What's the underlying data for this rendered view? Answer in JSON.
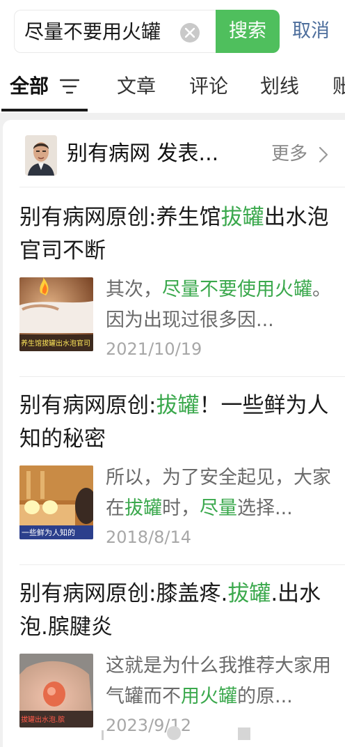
{
  "search": {
    "query": "尽量不要用火罐",
    "search_label": "搜索",
    "cancel_label": "取消"
  },
  "tabs": [
    {
      "label": "全部",
      "active": true
    },
    {
      "label": "文章",
      "active": false
    },
    {
      "label": "评论",
      "active": false
    },
    {
      "label": "划线",
      "active": false
    },
    {
      "label": "账",
      "active": false
    }
  ],
  "source": {
    "name": "别有病网 发表...",
    "more_label": "更多"
  },
  "results": [
    {
      "title_parts": [
        "别有病网原创:养生馆",
        "拔罐",
        "出水泡官司不断"
      ],
      "snippet_parts": [
        "其次，",
        "尽量不要使用火罐",
        "。因为出现过很多因..."
      ],
      "date": "2021/10/19",
      "thumb_caption": "养生馆拔罐出水泡官司"
    },
    {
      "title_parts": [
        "别有病网原创:",
        "拔罐",
        "！一些鲜为人知的秘密"
      ],
      "snippet_parts": [
        "所以，为了安全起见，大家在",
        "拔罐",
        "时，",
        "尽量",
        "选择..."
      ],
      "date": "2018/8/14",
      "thumb_caption": "一些鲜为人知的"
    },
    {
      "title_parts": [
        "别有病网原创:膝盖疼.",
        "拔罐",
        ".出水泡.膑腱炎"
      ],
      "snippet_parts": [
        "这就是为什么我推荐大家用气罐而不",
        "用火罐",
        "的原..."
      ],
      "date": "2023/9/12",
      "thumb_caption": "拔罐出水泡.膑"
    }
  ],
  "colors": {
    "accent_green": "#4fbf5d",
    "highlight_green": "#3aa84c",
    "cancel_blue": "#4d6e9c"
  },
  "icons": [
    "clear-icon",
    "filter-icon",
    "chevron-right-icon",
    "back-icon",
    "home-icon",
    "recents-icon"
  ]
}
